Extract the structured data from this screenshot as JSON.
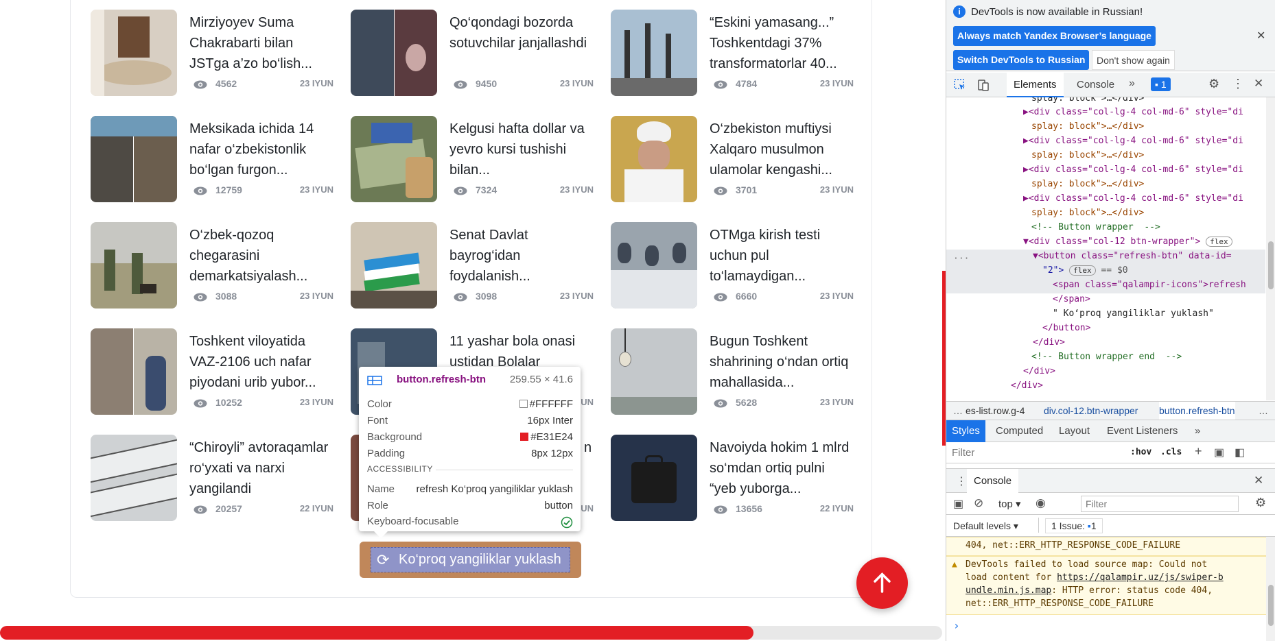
{
  "news": [
    {
      "title": "Mirziyoyev Suma Chakrabarti bilan JSTga a’zo bo‘lish...",
      "views": "4562",
      "date": "23 IYUN"
    },
    {
      "title": "Qo‘qondagi bozorda sotuvchilar janjallashdi",
      "views": "9450",
      "date": "23 IYUN"
    },
    {
      "title": "“Eskini yamasang...” Toshkentdagi 37% transformatorlar 40...",
      "views": "4784",
      "date": "23 IYUN"
    },
    {
      "title": "Meksikada ichida 14 nafar o‘zbekistonlik bo‘lgan furgon...",
      "views": "12759",
      "date": "23 IYUN"
    },
    {
      "title": "Kelgusi hafta dollar va yevro kursi tushishi bilan...",
      "views": "7324",
      "date": "23 IYUN"
    },
    {
      "title": "O‘zbekiston muftiysi Xalqaro musulmon ulamolar kengashi...",
      "views": "3701",
      "date": "23 IYUN"
    },
    {
      "title": "O‘zbek-qozoq chegarasini demarkatsiyalash...",
      "views": "3088",
      "date": "23 IYUN"
    },
    {
      "title": "Senat Davlat bayrog‘idan foydalanish...",
      "views": "3098",
      "date": "23 IYUN"
    },
    {
      "title": "OTMga kirish testi uchun pul to‘lamaydigan...",
      "views": "6660",
      "date": "23 IYUN"
    },
    {
      "title": "Toshkent viloyatida VAZ-2106 uch nafar piyodani urib yubor...",
      "views": "10252",
      "date": "23 IYUN"
    },
    {
      "title": "11 yashar bola onasi ustidan Bolalar",
      "views": "",
      "date": "UN"
    },
    {
      "title": "Bugun Toshkent shahrining o‘ndan ortiq mahallasida...",
      "views": "5628",
      "date": "23 IYUN"
    },
    {
      "title": "“Chiroyli” avtoraqamlar ro‘yxati va narxi yangilandi",
      "views": "20257",
      "date": "22 IYUN"
    },
    {
      "title": "n",
      "views": "",
      "date": "UN"
    },
    {
      "title": "Navoiyda hokim 1 mlrd so‘mdan ortiq pulni “yeb yuborga...",
      "views": "13656",
      "date": "22 IYUN"
    }
  ],
  "load_more": {
    "label": "Ko‘proq yangiliklar yuklash",
    "icon": "refresh-icon"
  },
  "tooltip": {
    "selector": "button.refresh-btn",
    "size": "259.55 × 41.6",
    "color_label": "Color",
    "color": "#FFFFFF",
    "font_label": "Font",
    "font": "16px Inter",
    "bg_label": "Background",
    "background": "#E31E24",
    "padding_label": "Padding",
    "padding": "8px 12px",
    "accessibility": "ACCESSIBILITY",
    "name_label": "Name",
    "name": "refresh Ko‘proq yangiliklar yuklash",
    "role_label": "Role",
    "role": "button",
    "focus_label": "Keyboard-focusable"
  },
  "colors": {
    "accent": "#E31E24",
    "devtools_blue": "#1a73e8"
  },
  "devtools": {
    "info": "DevTools is now available in Russian!",
    "btn_match": "Always match Yandex Browser’s language",
    "btn_switch": "Switch DevTools to Russian",
    "btn_dont": "Don't show again",
    "tabs": [
      "Elements",
      "Console"
    ],
    "badge": "1",
    "code": [
      "splay: block\">…</div>",
      "▶<div class=\"col-lg-4 col-md-6\" style=\"di",
      "splay: block\">…</div>",
      "▶<div class=\"col-lg-4 col-md-6\" style=\"di",
      "splay: block\">…</div>",
      "▶<div class=\"col-lg-4 col-md-6\" style=\"di",
      "splay: block\">…</div>",
      "▶<div class=\"col-lg-4 col-md-6\" style=\"di",
      "splay: block\">…</div>",
      "<!-- Button wrapper  -->",
      "▼<div class=\"col-12 btn-wrapper\">",
      "▼<button class=\"refresh-btn\" data-id=",
      "\"2\">",
      "<span class=\"qalampir-icons\">refresh",
      "</span>",
      "\" Ko‘proq yangiliklar yuklash\"",
      "</button>",
      "</div>",
      "<!-- Button wrapper end  -->",
      "</div>",
      "</div>"
    ],
    "flex": "flex",
    "eq0": "== $0",
    "crumbs": [
      "es-list.row.g-4",
      "div.col-12.btn-wrapper",
      "button.refresh-btn"
    ],
    "sub_tabs": [
      "Styles",
      "Computed",
      "Layout",
      "Event Listeners"
    ],
    "filter": "Filter",
    "hov": ":hov",
    "cls": ".cls",
    "console_title": "Console",
    "top": "top",
    "console_filter": "Filter",
    "levels": "Default levels",
    "issues": "1 Issue:",
    "issues_count": "1",
    "msg1": "404, net::ERR_HTTP_RESPONSE_CODE_FAILURE",
    "msg2a": "DevTools failed to load source map: Could not",
    "msg2b": "load content for ",
    "msg2link1": "https://qalampir.uz/js/swiper-b",
    "msg2link2": "undle.min.js.map",
    "msg2c": ": HTTP error: status code 404,",
    "msg2d": "net::ERR_HTTP_RESPONSE_CODE_FAILURE",
    "prompt": "›"
  },
  "page_scroll_fraction": 0.8
}
